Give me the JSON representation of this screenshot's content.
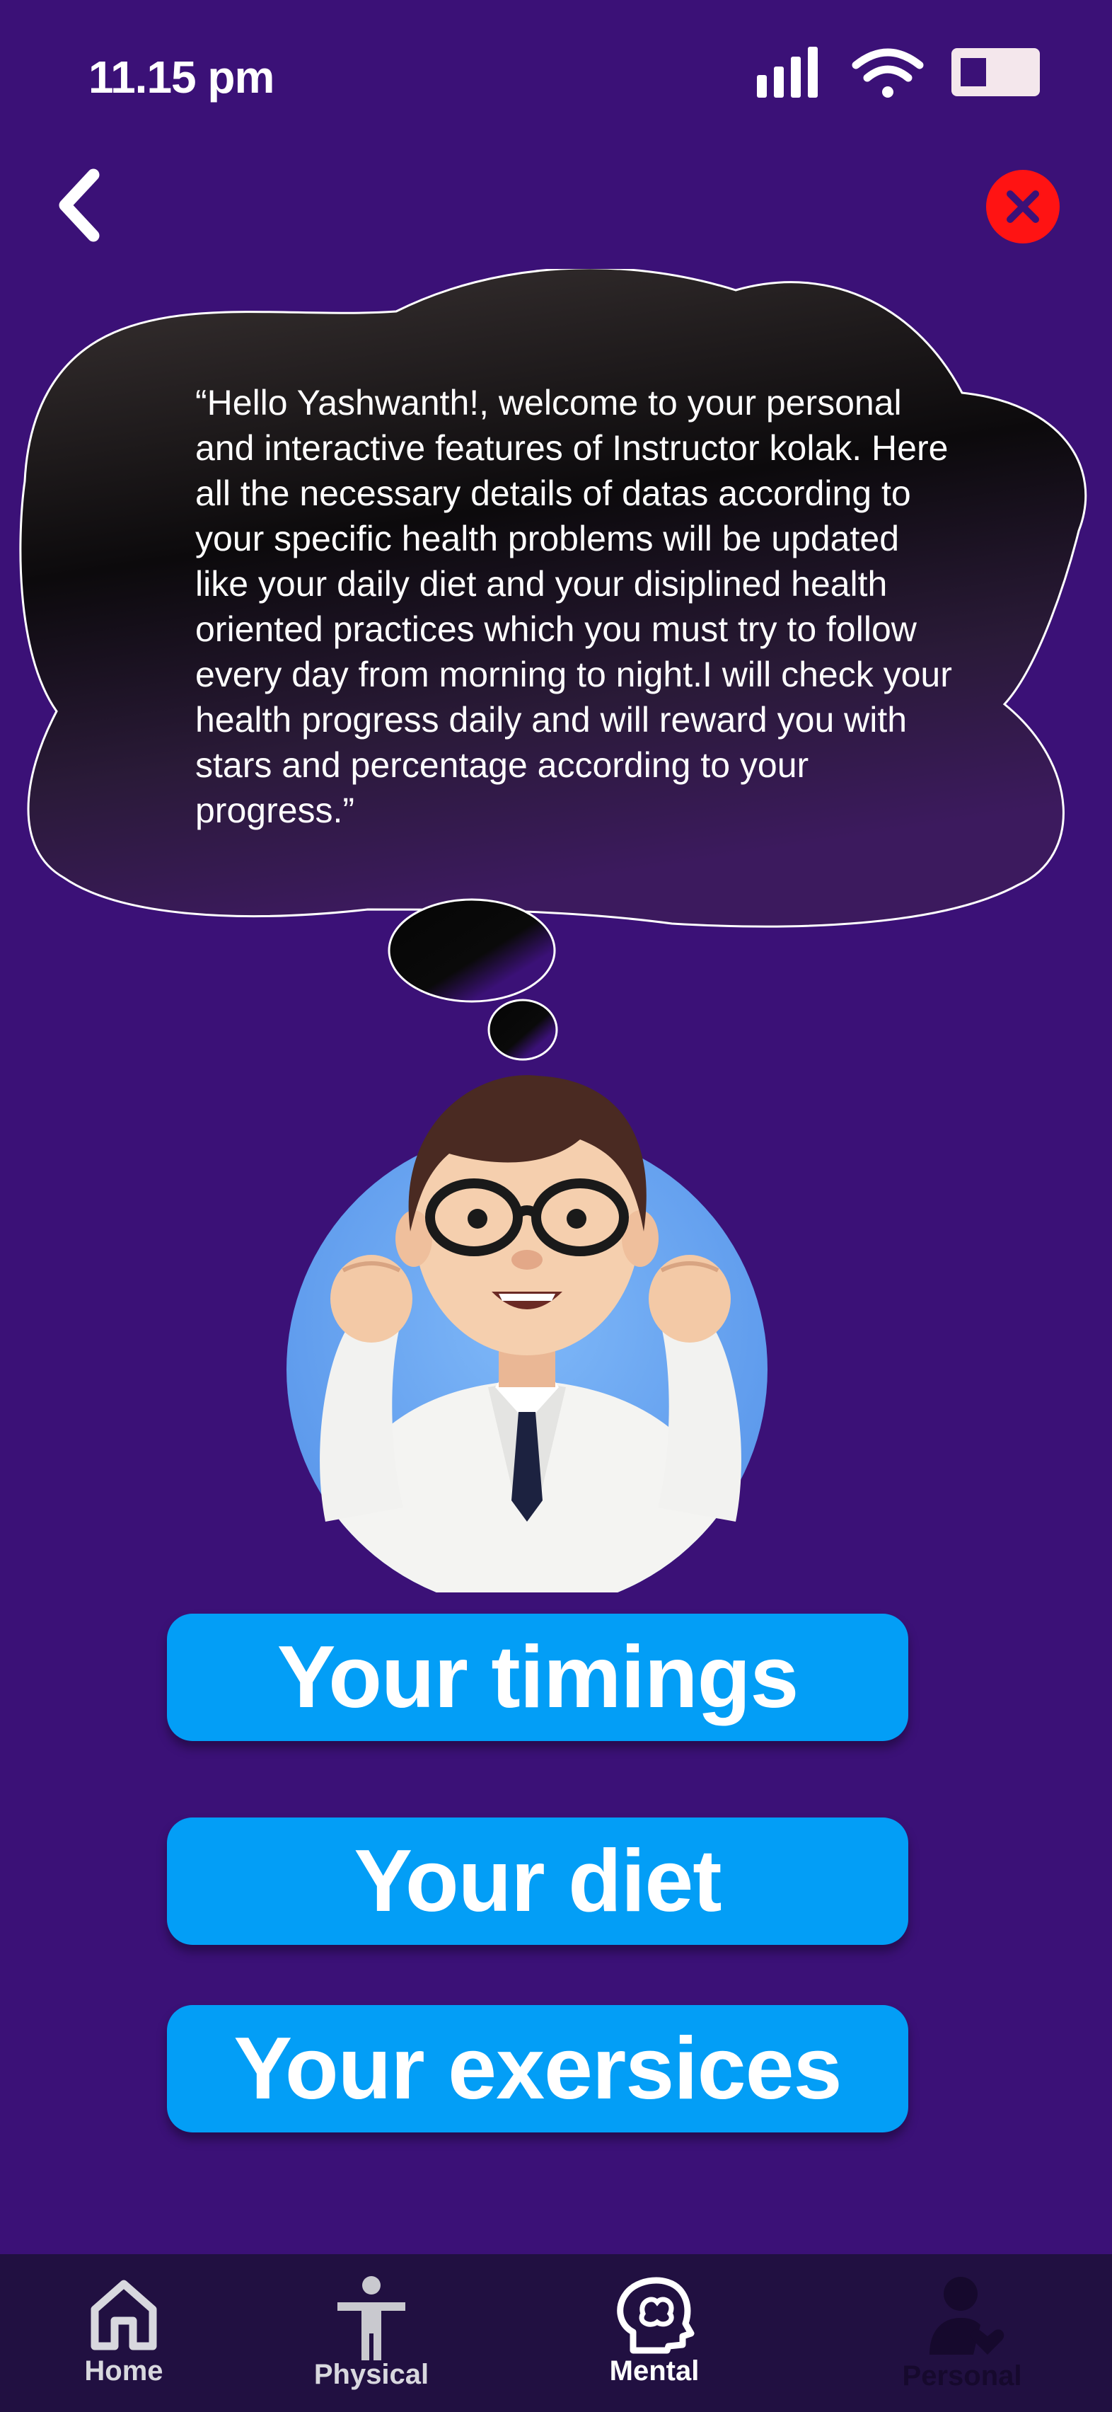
{
  "status_bar": {
    "time": "11.15 pm",
    "icons": [
      "signal-icon",
      "wifi-icon",
      "battery-icon"
    ]
  },
  "header": {
    "back_icon": "chevron-left-icon",
    "close_icon": "close-icon"
  },
  "bubble": {
    "text": "“Hello Yashwanth!, welcome to your personal and interactive features of Instructor kolak. Here all the necessary details of datas according to your specific health problems will be updated like your daily diet and your disiplined health oriented practices which you must try to follow every day from morning to night.I will check your health progress daily and will reward you with stars and percentage according to your progress.”"
  },
  "avatar": {
    "icon": "instructor-avatar"
  },
  "buttons": {
    "timings": "Your timings",
    "diet": "Your diet",
    "exercises": "Your exersices"
  },
  "bottom_nav": {
    "items": [
      {
        "label": "Home",
        "icon": "home-icon",
        "active": false
      },
      {
        "label": "Physical",
        "icon": "person-icon",
        "active": false
      },
      {
        "label": "Mental",
        "icon": "brain-icon",
        "active": true
      },
      {
        "label": "Personal",
        "icon": "personal-icon",
        "active": false
      }
    ]
  },
  "colors": {
    "background": "#3b1177",
    "button": "#039ef6",
    "close": "#ff1313",
    "nav_background": "#211041"
  }
}
